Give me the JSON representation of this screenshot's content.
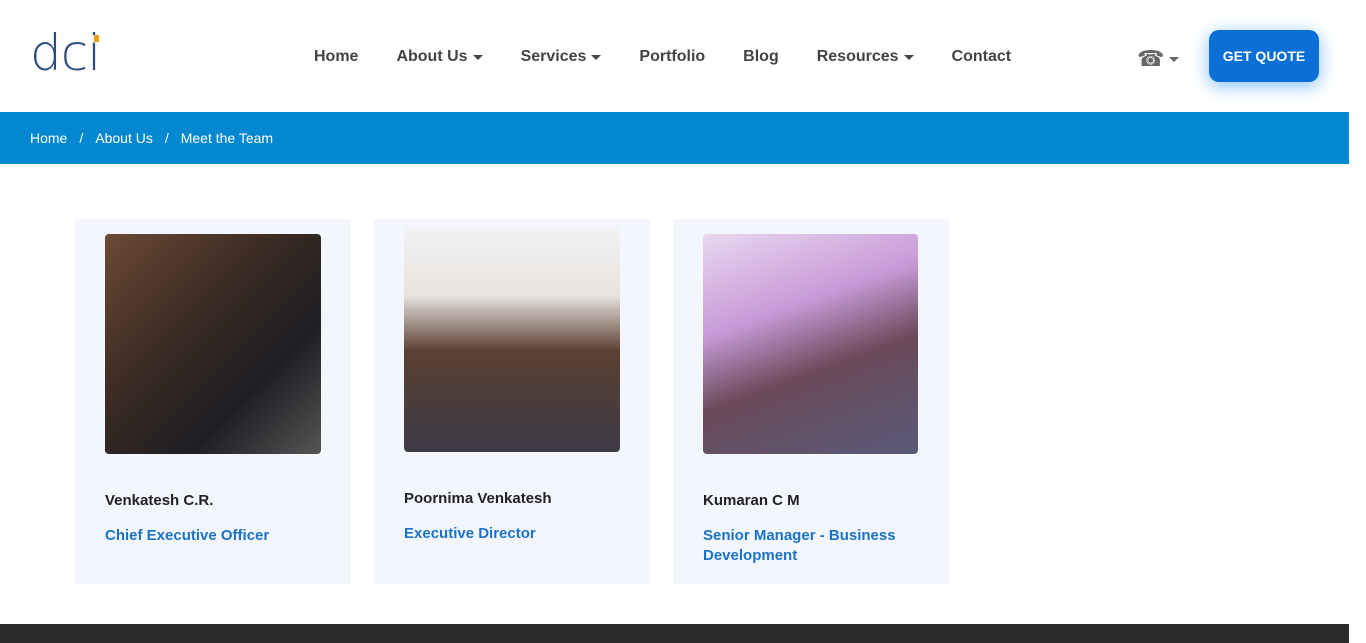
{
  "header": {
    "logo": "dci",
    "nav": [
      {
        "label": "Home",
        "dropdown": false
      },
      {
        "label": "About Us",
        "dropdown": true
      },
      {
        "label": "Services",
        "dropdown": true
      },
      {
        "label": "Portfolio",
        "dropdown": false
      },
      {
        "label": "Blog",
        "dropdown": false
      },
      {
        "label": "Resources",
        "dropdown": true
      },
      {
        "label": "Contact",
        "dropdown": false
      }
    ],
    "phone_icon": "☎",
    "cta": "GET QUOTE"
  },
  "breadcrumb": [
    "Home",
    "About Us",
    "Meet the Team"
  ],
  "team": [
    {
      "name": "Venkatesh C.R.",
      "role": "Chief Executive Officer"
    },
    {
      "name": "Poornima Venkatesh",
      "role": "Executive Director"
    },
    {
      "name": "Kumaran C M",
      "role": "Senior Manager - Business Development"
    }
  ]
}
